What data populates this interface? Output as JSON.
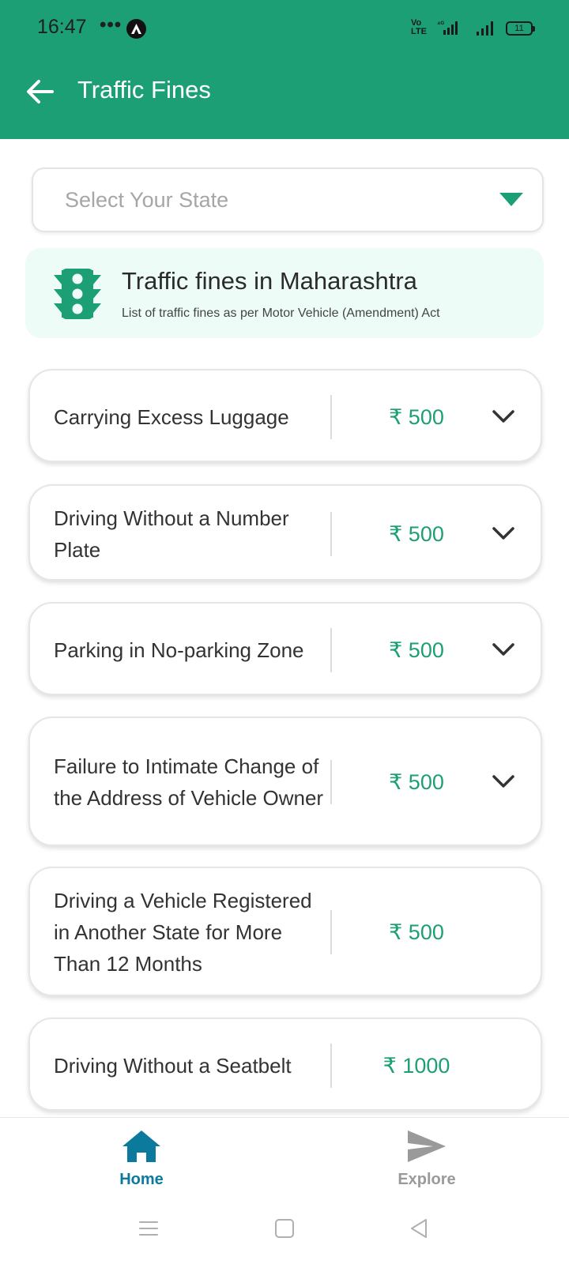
{
  "status_bar": {
    "time": "16:47",
    "dots": "•••",
    "volte": "Vo LTE",
    "network": "4G",
    "battery": "11"
  },
  "app_bar": {
    "title": "Traffic Fines"
  },
  "state_select": {
    "placeholder": "Select Your State"
  },
  "info_banner": {
    "title": "Traffic fines in Maharashtra",
    "subtitle": "List of traffic fines as per Motor Vehicle (Amendment) Act"
  },
  "fines": [
    {
      "name": "Carrying Excess Luggage",
      "amount": "₹ 500",
      "expandable": true
    },
    {
      "name": "Driving Without a Number Plate",
      "amount": "₹ 500",
      "expandable": true
    },
    {
      "name": "Parking in No-parking Zone",
      "amount": "₹ 500",
      "expandable": true
    },
    {
      "name": "Failure to Intimate Change of the Address of Vehicle Owner",
      "amount": "₹ 500",
      "expandable": true
    },
    {
      "name": "Driving a Vehicle Registered in Another State for More Than 12 Months",
      "amount": "₹ 500",
      "expandable": false
    },
    {
      "name": "Driving Without a Seatbelt",
      "amount": "₹ 1000",
      "expandable": false
    }
  ],
  "bottom_nav": {
    "home": "Home",
    "explore": "Explore"
  },
  "colors": {
    "brand": "#1c9f74",
    "active_nav": "#0b7a9c",
    "inactive_nav": "#9a9a9a"
  }
}
